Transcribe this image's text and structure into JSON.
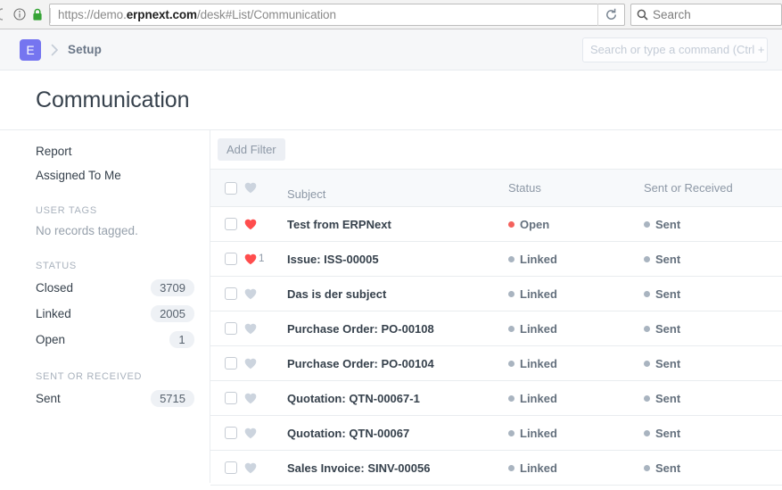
{
  "browser": {
    "url_prefix": "https://demo.",
    "url_domain": "erpnext.com",
    "url_suffix": "/desk#List/Communication",
    "search_placeholder": "Search",
    "reload_title": "Reload",
    "lock_label": "secure-connection",
    "info_label": "site-information"
  },
  "navbar": {
    "logo_letter": "E",
    "breadcrumb": "Setup",
    "awesomebar_placeholder": "Search or type a command (Ctrl + G)"
  },
  "page": {
    "title": "Communication"
  },
  "sidebar": {
    "links": [
      {
        "label": "Report"
      },
      {
        "label": "Assigned To Me"
      }
    ],
    "user_tags": {
      "title": "USER TAGS",
      "empty": "No records tagged."
    },
    "status": {
      "title": "STATUS",
      "items": [
        {
          "label": "Closed",
          "count": "3709"
        },
        {
          "label": "Linked",
          "count": "2005"
        },
        {
          "label": "Open",
          "count": "1"
        }
      ]
    },
    "sent_or_received": {
      "title": "SENT OR RECEIVED",
      "items": [
        {
          "label": "Sent",
          "count": "5715"
        }
      ]
    }
  },
  "toolbar": {
    "add_filter_label": "Add Filter"
  },
  "list": {
    "columns": {
      "subject": "Subject",
      "status": "Status",
      "sent_or_received": "Sent or Received"
    },
    "rows": [
      {
        "subject": "Test from ERPNext",
        "status": "Open",
        "status_color": "#f4615c",
        "sor": "Sent",
        "sor_color": "#a9b4c0",
        "liked": true,
        "like_count": ""
      },
      {
        "subject": "Issue: ISS-00005",
        "status": "Linked",
        "status_color": "#a9b4c0",
        "sor": "Sent",
        "sor_color": "#a9b4c0",
        "liked": true,
        "like_count": "1"
      },
      {
        "subject": "Das is der subject",
        "status": "Linked",
        "status_color": "#a9b4c0",
        "sor": "Sent",
        "sor_color": "#a9b4c0",
        "liked": false,
        "like_count": ""
      },
      {
        "subject": "Purchase Order: PO-00108",
        "status": "Linked",
        "status_color": "#a9b4c0",
        "sor": "Sent",
        "sor_color": "#a9b4c0",
        "liked": false,
        "like_count": ""
      },
      {
        "subject": "Purchase Order: PO-00104",
        "status": "Linked",
        "status_color": "#a9b4c0",
        "sor": "Sent",
        "sor_color": "#a9b4c0",
        "liked": false,
        "like_count": ""
      },
      {
        "subject": "Quotation: QTN-00067-1",
        "status": "Linked",
        "status_color": "#a9b4c0",
        "sor": "Sent",
        "sor_color": "#a9b4c0",
        "liked": false,
        "like_count": ""
      },
      {
        "subject": "Quotation: QTN-00067",
        "status": "Linked",
        "status_color": "#a9b4c0",
        "sor": "Sent",
        "sor_color": "#a9b4c0",
        "liked": false,
        "like_count": ""
      },
      {
        "subject": "Sales Invoice: SINV-00056",
        "status": "Linked",
        "status_color": "#a9b4c0",
        "sor": "Sent",
        "sor_color": "#a9b4c0",
        "liked": false,
        "like_count": ""
      }
    ]
  },
  "colors": {
    "brand_purple": "#7575f0",
    "open_red": "#f4615c",
    "neutral_gray": "#a9b4c0",
    "heart_red": "#ff4d4d",
    "heart_gray": "#ccd4de"
  }
}
